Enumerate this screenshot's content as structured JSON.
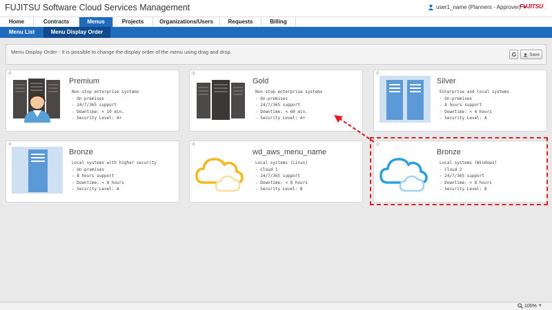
{
  "app": {
    "title": "FUJITSU Software Cloud Services Management",
    "user_label": "user1_name (Planners - Approver)",
    "brand": "FUJITSU"
  },
  "main_nav": [
    {
      "label": "Home",
      "active": false
    },
    {
      "label": "Contracts",
      "active": false
    },
    {
      "label": "Menus",
      "active": true
    },
    {
      "label": "Projects",
      "active": false
    },
    {
      "label": "Organizations/Users",
      "active": false
    },
    {
      "label": "Requests",
      "active": false
    },
    {
      "label": "Billing",
      "active": false
    }
  ],
  "sub_nav": [
    {
      "label": "Menu List",
      "active": false
    },
    {
      "label": "Menu Display Order",
      "active": true
    }
  ],
  "info": {
    "text": "Menu Display Order - It is possible to change the display order of the menu using drag and drop.",
    "save_label": "Save"
  },
  "menus": [
    {
      "title": "Premium",
      "icon": "server-with-operator-icon",
      "lines": [
        "Non-stop enterprise systems",
        "- On-premises",
        "- 24/7/365 support",
        "- Downtime: < 10 min.",
        "- Security Level: A+"
      ]
    },
    {
      "title": "Gold",
      "icon": "dark-server-icon",
      "lines": [
        "Non-stop enterprise systems",
        "- On-premises",
        "- 24/7/365 support",
        "- Downtime: < 60 min.",
        "- Security Level: A+"
      ]
    },
    {
      "title": "Silver",
      "icon": "blue-server-pair-icon",
      "lines": [
        "Enterprise and local systems",
        "- On-premises",
        "- 8 hours support",
        "- Downtime: < 4 hours",
        "- Security Level: A"
      ]
    },
    {
      "title": "Bronze",
      "icon": "blue-server-icon",
      "lines": [
        "Local systems with higher security",
        "- On-premises",
        "- 8 hours support",
        "- Downtime: < 8 hours",
        "- Security Level: A"
      ]
    },
    {
      "title": "wd_aws_menu_name",
      "icon": "yellow-cloud-icon",
      "lines": [
        "Local systems (Linux)",
        "- Cloud 1",
        "- 24/7/365 support",
        "- Downtime: < 8 hours",
        "- Security Level: B"
      ]
    },
    {
      "title": "Bronze",
      "icon": "blue-cloud-icon",
      "lines": [
        "Local systems (Windows)",
        "- Cloud 2",
        "- 24/7/365 support",
        "- Downtime: < 8 hours",
        "- Security Level: B"
      ]
    }
  ],
  "status": {
    "zoom": "100%"
  }
}
